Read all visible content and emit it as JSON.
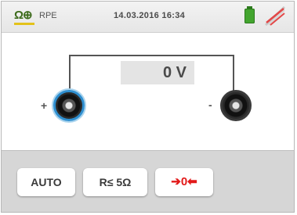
{
  "header": {
    "function_icon": "Ω⊕",
    "function_label": "RPE",
    "datetime": "14.03.2016 16:34",
    "battery_icon": "battery-icon",
    "signal_icon": "no-signal-icon",
    "colors": {
      "battery": "#43a52f",
      "signal_slash": "#e34848"
    }
  },
  "measurement": {
    "value": "0 V",
    "plus_label": "+",
    "minus_label": "-"
  },
  "softkeys": {
    "auto_label": "AUTO",
    "range_label": "R≤ 5Ω",
    "zero_label": "➔0⬅"
  }
}
